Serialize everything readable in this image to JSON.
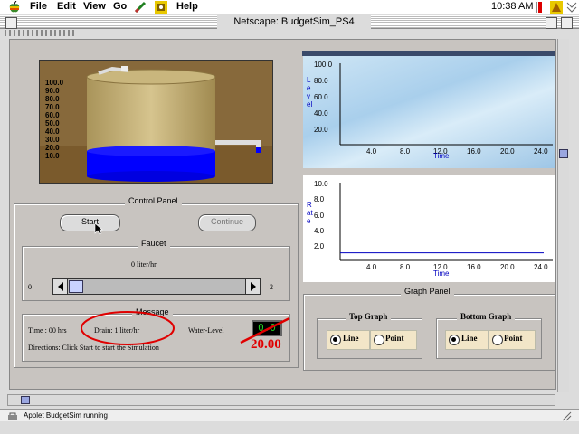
{
  "menubar": {
    "items": [
      "File",
      "Edit",
      "View",
      "Go",
      "Help"
    ],
    "clock": "10:38 AM"
  },
  "window": {
    "title": "Netscape: BudgetSim_PS4"
  },
  "tank": {
    "level_labels": [
      "100.0",
      "90.0",
      "80.0",
      "70.0",
      "60.0",
      "50.0",
      "40.0",
      "30.0",
      "20.0",
      "10.0"
    ],
    "water_fill": 0.2
  },
  "top_graph": {
    "y_axis_label": "Level",
    "y_ticks": [
      "100.0",
      "80.0",
      "60.0",
      "40.0",
      "20.0"
    ],
    "x_ticks": [
      "4.0",
      "8.0",
      "12.0",
      "16.0",
      "20.0",
      "24.0"
    ],
    "x_label": "Time"
  },
  "bottom_graph": {
    "y_axis_label": "Rate",
    "y_ticks": [
      "10.0",
      "8.0",
      "6.0",
      "4.0",
      "2.0"
    ],
    "x_ticks": [
      "4.0",
      "8.0",
      "12.0",
      "16.0",
      "20.0",
      "24.0"
    ],
    "x_label": "Time",
    "rate_value": 1.0
  },
  "control_panel": {
    "title": "Control Panel",
    "start_label": "Start",
    "continue_label": "Continue",
    "faucet": {
      "title": "Faucet",
      "value_text": "0 liter/hr",
      "min_label": "0",
      "max_label": "2",
      "slider_value": 0
    },
    "message": {
      "title": "Message",
      "time_text": "Time : 00 hrs",
      "drain_text": "Drain: 1 liter/hr",
      "water_level_label": "Water-Level",
      "water_level_display": "0.0",
      "annotation_value": "20.00",
      "directions": "Directions: Click Start to start the Simulation"
    }
  },
  "graph_panel": {
    "title": "Graph Panel",
    "top_graph_title": "Top Graph",
    "bottom_graph_title": "Bottom Graph",
    "line_label": "Line",
    "point_label": "Point"
  },
  "status_bar": {
    "text": "Applet BudgetSim running"
  },
  "colors": {
    "water": "#0000ff",
    "annotation": "#e00000",
    "axis_label": "#0000c0"
  }
}
